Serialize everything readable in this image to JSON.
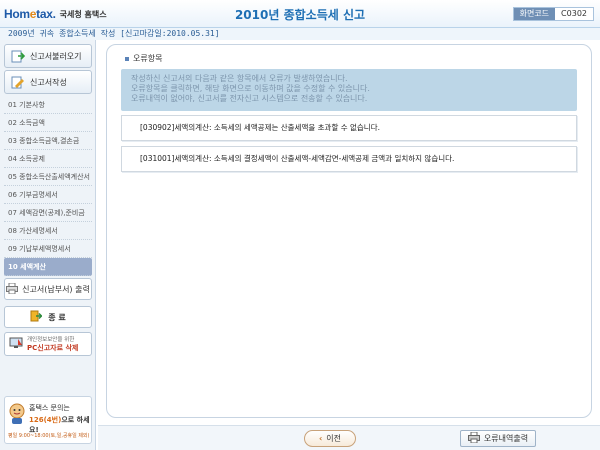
{
  "header": {
    "logo_text": "Hometax",
    "logo_sub": "국세청 홈택스",
    "title": "2010년 종합소득세 신고",
    "screen_code_label": "화면코드",
    "screen_code_value": "C0302"
  },
  "subheader": {
    "text": "2009년 귀속 종합소득세 작성 [신고마감일:2010.05.31]"
  },
  "sidebar": {
    "load_button": "신고서불러오기",
    "write_button": "신고서작성",
    "items": [
      {
        "label": "01 기본사항"
      },
      {
        "label": "02 소득금액"
      },
      {
        "label": "03 종합소득금액,결손금"
      },
      {
        "label": "04 소득공제"
      },
      {
        "label": "05 종합소득산출세액계산서"
      },
      {
        "label": "06 기부금명세서"
      },
      {
        "label": "07 세액감면(공제),준비금"
      },
      {
        "label": "08 가산세명세서"
      },
      {
        "label": "09 기납부세액명세서"
      },
      {
        "label": "10 세액계산"
      }
    ],
    "active_index": 9,
    "print_button": "신고서(납부서) 출력",
    "end_button": "종 료",
    "pc_notice_1": "개인정보보안을 위한",
    "pc_notice_2": "PC신고자료 삭제",
    "help_line1": "홈택스 문의는",
    "help_number": "126(4번)",
    "help_suffix": "으로 하세요!",
    "help_hours": "평일 9:00~18:00(토,일,공휴일 제외)"
  },
  "main": {
    "section_title": "오류항목",
    "info_lines": [
      "작성하신 신고서의 다음과 같은 항목에서 오류가 발생하였습니다.",
      "오류항목을 클릭하면, 해당 화면으로 이동하며 값을 수정할 수 있습니다.",
      "오류내역이 없어야, 신고서를 전자신고 시스템으로 전송할 수 있습니다."
    ],
    "errors": [
      "[030902]세액의계산: 소득세의 세액공제는 산출세액을 초과할 수 없습니다.",
      "[031001]세액의계산: 소득세의 결정세액이 산출세액-세액감면-세액공제 금액과 일치하지 않습니다."
    ]
  },
  "footer": {
    "prev_button": "이전",
    "print_error_button": "오류내역출력"
  },
  "colors": {
    "brand_blue": "#1e6fb4",
    "info_bg": "#bcd6e7",
    "active_nav": "#9aaccb"
  }
}
